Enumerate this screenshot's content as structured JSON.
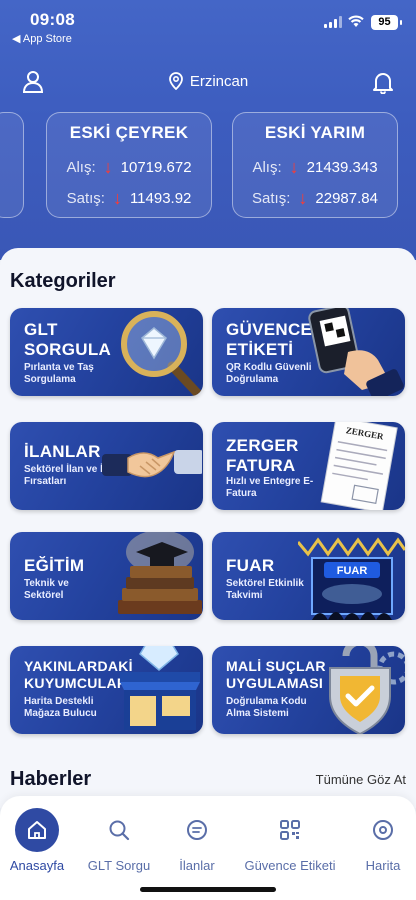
{
  "status": {
    "time": "09:08",
    "back": "◀ App Store",
    "battery": "95"
  },
  "header": {
    "location": "Erzincan"
  },
  "rates": [
    {
      "title": "ESKİ ÇEYREK",
      "buy_label": "Alış:",
      "buy": "10719.672",
      "sell_label": "Satış:",
      "sell": "11493.92"
    },
    {
      "title": "ESKİ YARIM",
      "buy_label": "Alış:",
      "buy": "21439.343",
      "sell_label": "Satış:",
      "sell": "22987.84"
    }
  ],
  "categories_title": "Kategoriler",
  "categories": [
    {
      "title": "GLT SORGULA",
      "subtitle": "Pırlanta ve Taş Sorgulama"
    },
    {
      "title": "GÜVENCE ETİKETİ",
      "subtitle": "QR Kodlu Güvenli Doğrulama"
    },
    {
      "title": "İLANLAR",
      "subtitle": "Sektörel İlan ve İş Fırsatları"
    },
    {
      "title": "ZERGER FATURA",
      "subtitle": "Hızlı ve Entegre E-Fatura"
    },
    {
      "title": "EĞİTİM",
      "subtitle": "Teknik ve Sektörel"
    },
    {
      "title": "FUAR",
      "subtitle": "Sektörel Etkinlik Takvimi"
    },
    {
      "title": "YAKINLARDAKİ KUYUMCULAR",
      "subtitle": "Harita Destekli Mağaza Bulucu"
    },
    {
      "title": "MALİ SUÇLAR UYGULAMASI",
      "subtitle": "Doğrulama Kodu Alma Sistemi"
    }
  ],
  "art": {
    "zerger_doc": "ZERGER",
    "fuar_banner": "FUAR"
  },
  "news": {
    "title": "Haberler",
    "see_all": "Tümüne Göz At"
  },
  "tabs": [
    {
      "label": "Anasayfa",
      "icon": "home-icon"
    },
    {
      "label": "GLT Sorgu",
      "icon": "search-icon"
    },
    {
      "label": "İlanlar",
      "icon": "listings-icon"
    },
    {
      "label": "Güvence Etiketi",
      "icon": "qr-code-icon"
    },
    {
      "label": "Harita",
      "icon": "map-pin-icon"
    }
  ],
  "colors": {
    "primary": "#3d5dbf",
    "card": "#2443a0",
    "down_arrow": "#ff3b30",
    "active_tab": "#2f4aa3"
  }
}
